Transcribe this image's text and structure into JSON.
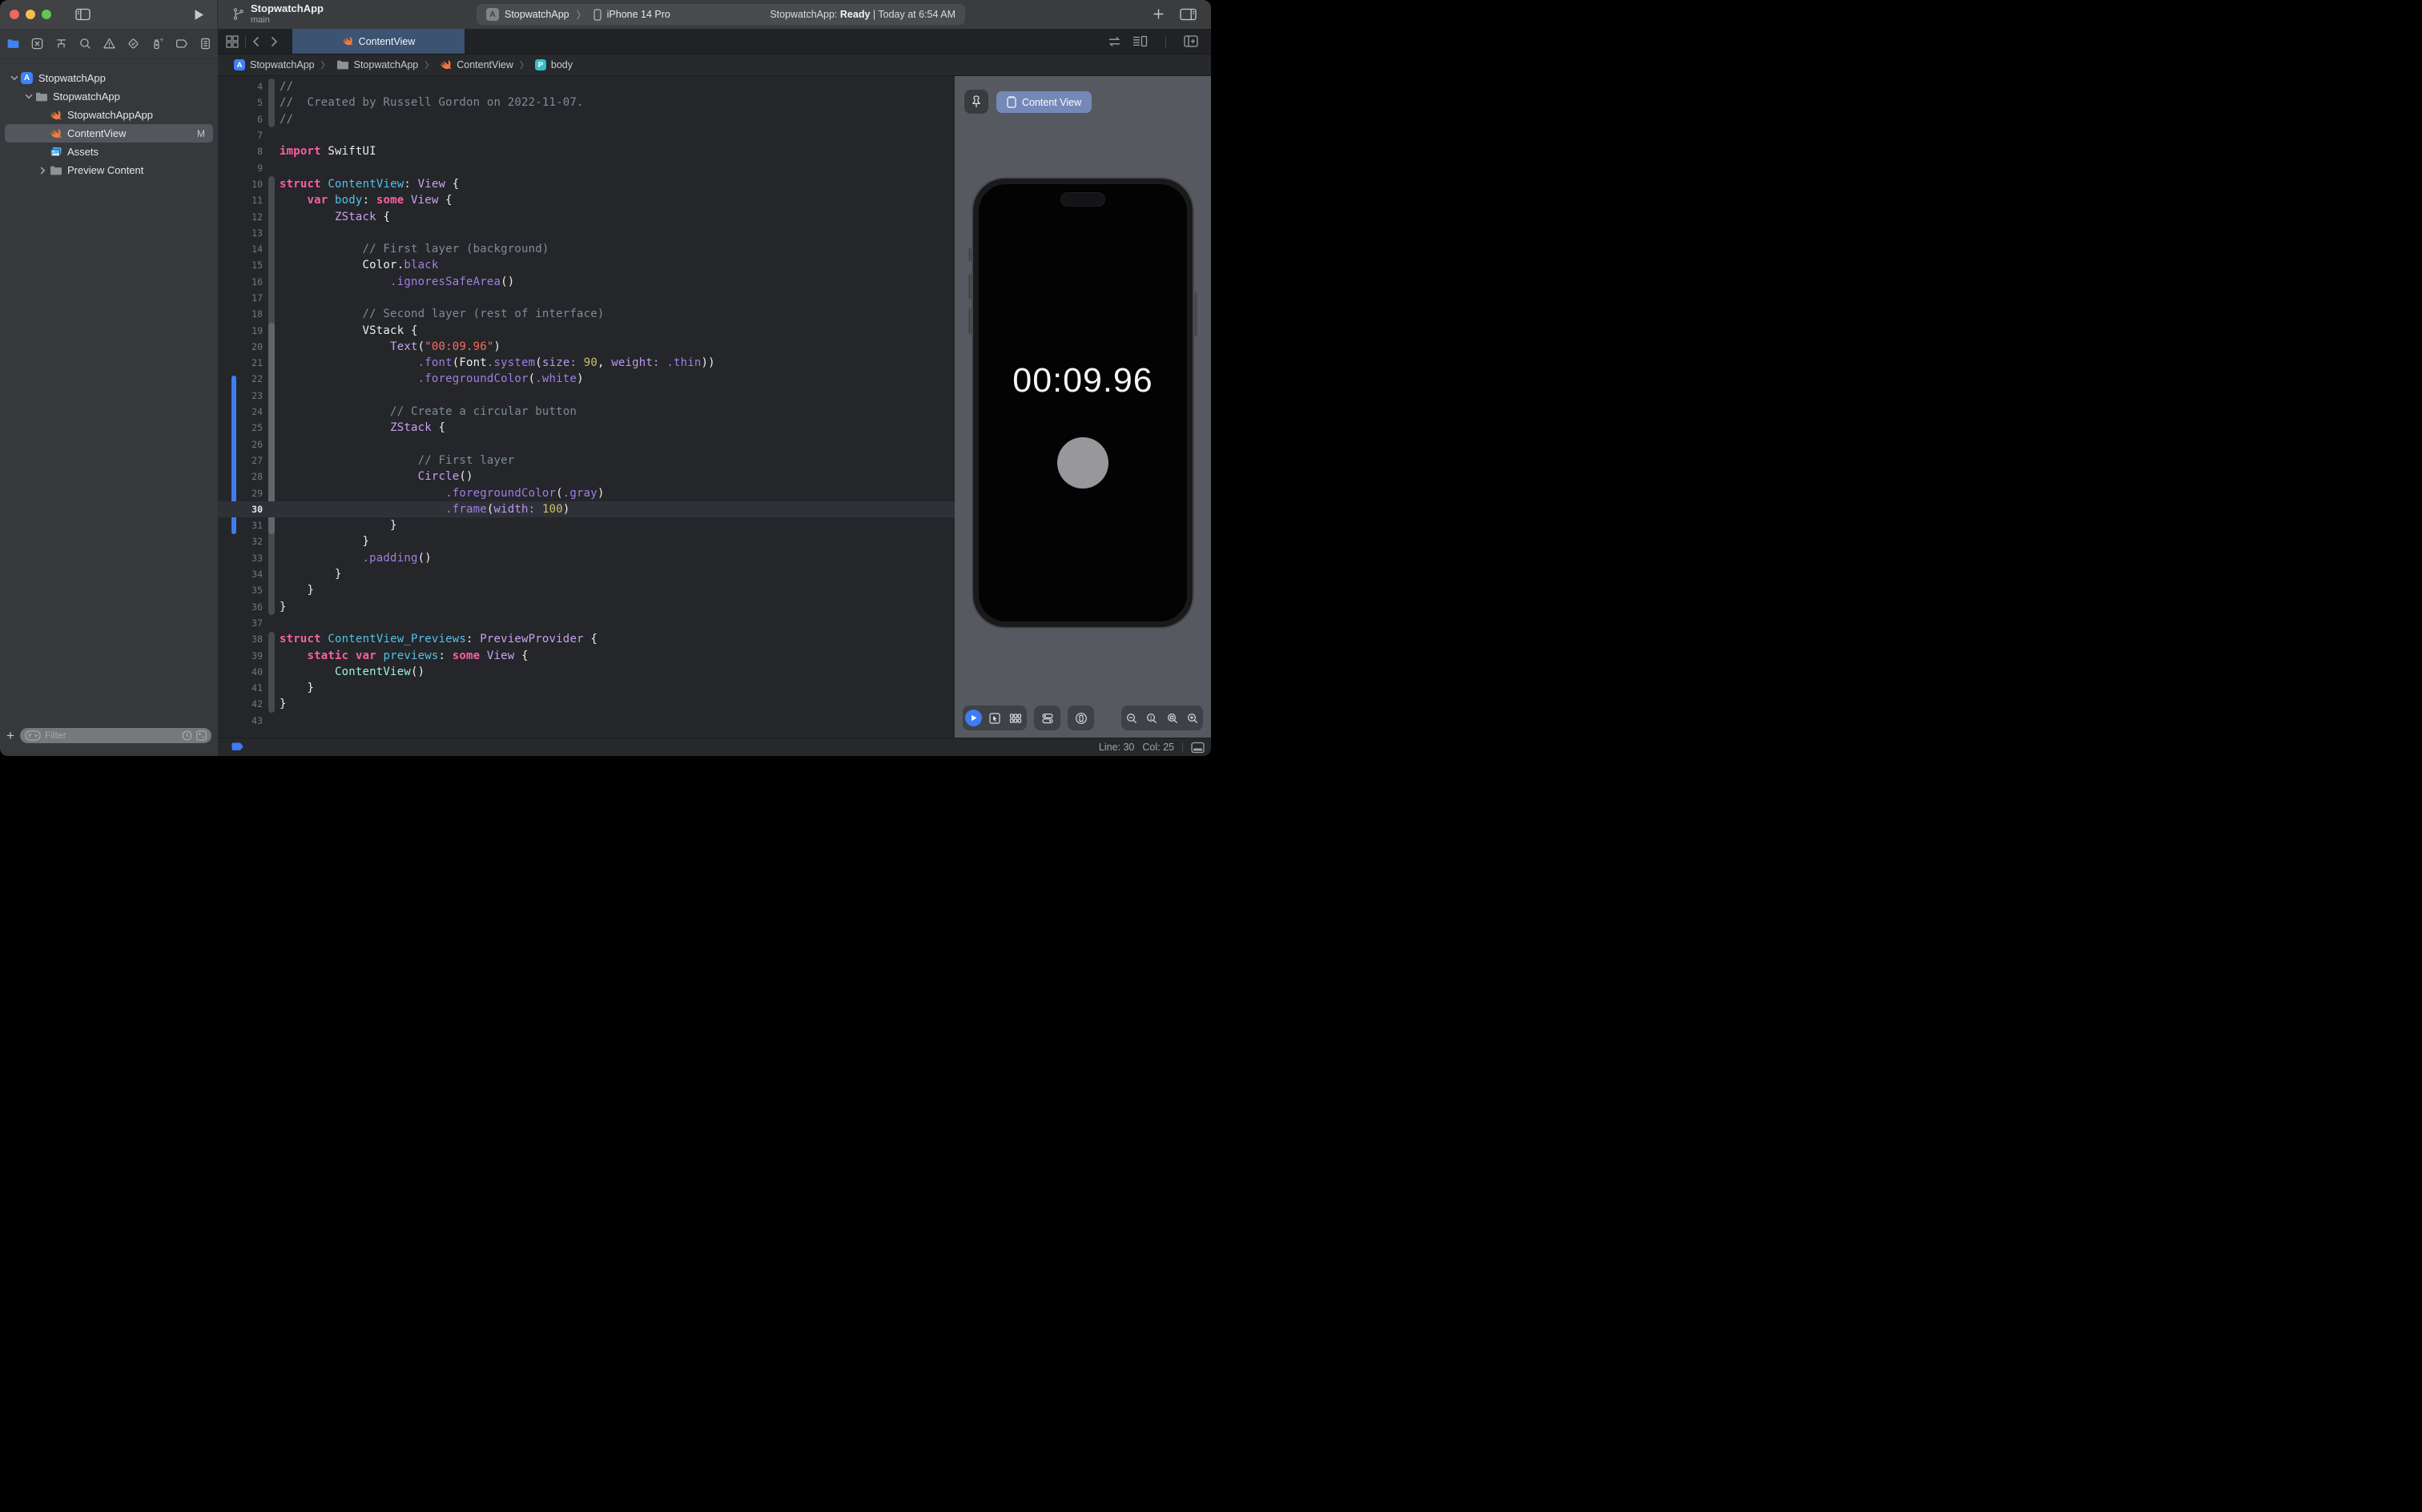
{
  "titlebar": {
    "project": "StopwatchApp",
    "branch": "main",
    "scheme": {
      "app": "StopwatchApp",
      "chevron": "〉",
      "device": "iPhone 14 Pro",
      "app_initial": "A"
    },
    "status": {
      "app": "StopwatchApp:",
      "state": "Ready",
      "sep": "|",
      "time": "Today at 6:54 AM"
    }
  },
  "navigator": {
    "active": "project-navigator",
    "icons": [
      "project-navigator",
      "source-control",
      "symbols",
      "find",
      "issues",
      "tests",
      "debug",
      "breakpoints",
      "reports"
    ]
  },
  "sidebar": {
    "items": [
      {
        "label": "StopwatchApp",
        "icon": "project",
        "disclosure": "open",
        "indent": 0
      },
      {
        "label": "StopwatchApp",
        "icon": "folder",
        "disclosure": "open",
        "indent": 1
      },
      {
        "label": "StopwatchAppApp",
        "icon": "swift",
        "indent": 2
      },
      {
        "label": "ContentView",
        "icon": "swift",
        "indent": 2,
        "selected": true,
        "badge": "M"
      },
      {
        "label": "Assets",
        "icon": "assets",
        "indent": 2
      },
      {
        "label": "Preview Content",
        "icon": "folder",
        "disclosure": "closed",
        "indent": 2
      }
    ],
    "filter": {
      "placeholder": "Filter"
    }
  },
  "tabbar": {
    "tab": {
      "label": "ContentView",
      "icon": "swift"
    }
  },
  "jumpbar": {
    "crumbs": [
      {
        "icon": "app",
        "label": "StopwatchApp"
      },
      {
        "icon": "folder",
        "label": "StopwatchApp"
      },
      {
        "icon": "swift",
        "label": "ContentView"
      },
      {
        "icon": "property",
        "label": "body"
      }
    ],
    "chevron": "〉"
  },
  "editor": {
    "current_line": 30,
    "lines": [
      {
        "n": 4,
        "t": [
          [
            "c",
            "//"
          ]
        ]
      },
      {
        "n": 5,
        "t": [
          [
            "c",
            "//  Created by Russell Gordon on 2022-11-07."
          ]
        ]
      },
      {
        "n": 6,
        "t": [
          [
            "c",
            "//"
          ]
        ]
      },
      {
        "n": 7,
        "t": []
      },
      {
        "n": 8,
        "t": [
          [
            "k",
            "import"
          ],
          [
            "p",
            " SwiftUI"
          ]
        ]
      },
      {
        "n": 9,
        "t": []
      },
      {
        "n": 10,
        "t": [
          [
            "k",
            "struct"
          ],
          [
            "p",
            " "
          ],
          [
            "d",
            "ContentView"
          ],
          [
            "p",
            ": "
          ],
          [
            "t",
            "View"
          ],
          [
            "p",
            " {"
          ]
        ]
      },
      {
        "n": 11,
        "t": [
          [
            "p",
            "    "
          ],
          [
            "k",
            "var"
          ],
          [
            "p",
            " "
          ],
          [
            "d",
            "body"
          ],
          [
            "p",
            ": "
          ],
          [
            "k",
            "some"
          ],
          [
            "p",
            " "
          ],
          [
            "t",
            "View"
          ],
          [
            "p",
            " {"
          ]
        ]
      },
      {
        "n": 12,
        "t": [
          [
            "p",
            "        "
          ],
          [
            "t",
            "ZStack"
          ],
          [
            "p",
            " {"
          ]
        ]
      },
      {
        "n": 13,
        "t": []
      },
      {
        "n": 14,
        "t": [
          [
            "c",
            "            // First layer (background)"
          ]
        ]
      },
      {
        "n": 15,
        "t": [
          [
            "p",
            "            Color."
          ],
          [
            "f",
            "black"
          ]
        ]
      },
      {
        "n": 16,
        "t": [
          [
            "p",
            "                "
          ],
          [
            "f",
            ".ignoresSafeArea"
          ],
          [
            "p",
            "()"
          ]
        ]
      },
      {
        "n": 17,
        "t": []
      },
      {
        "n": 18,
        "t": [
          [
            "c",
            "            // Second layer (rest of interface)"
          ]
        ]
      },
      {
        "n": 19,
        "t": [
          [
            "p",
            "            VStack {"
          ]
        ]
      },
      {
        "n": 20,
        "t": [
          [
            "p",
            "                "
          ],
          [
            "t",
            "Text"
          ],
          [
            "p",
            "("
          ],
          [
            "s",
            "\"00:09.96\""
          ],
          [
            "p",
            ")"
          ]
        ]
      },
      {
        "n": 21,
        "t": [
          [
            "p",
            "                    "
          ],
          [
            "f",
            ".font"
          ],
          [
            "p",
            "(Font"
          ],
          [
            "f",
            ".system"
          ],
          [
            "p",
            "("
          ],
          [
            "a",
            "size:"
          ],
          [
            "p",
            " "
          ],
          [
            "n",
            "90"
          ],
          [
            "p",
            ", "
          ],
          [
            "a",
            "weight:"
          ],
          [
            "p",
            " "
          ],
          [
            "f",
            ".thin"
          ],
          [
            "p",
            "))"
          ]
        ]
      },
      {
        "n": 22,
        "t": [
          [
            "p",
            "                    "
          ],
          [
            "f",
            ".foregroundColor"
          ],
          [
            "p",
            "("
          ],
          [
            "f",
            ".white"
          ],
          [
            "p",
            ")"
          ]
        ]
      },
      {
        "n": 23,
        "t": []
      },
      {
        "n": 24,
        "t": [
          [
            "c",
            "                // Create a circular button"
          ]
        ]
      },
      {
        "n": 25,
        "t": [
          [
            "p",
            "                "
          ],
          [
            "t",
            "ZStack"
          ],
          [
            "p",
            " {"
          ]
        ]
      },
      {
        "n": 26,
        "t": []
      },
      {
        "n": 27,
        "t": [
          [
            "c",
            "                    // First layer"
          ]
        ]
      },
      {
        "n": 28,
        "t": [
          [
            "p",
            "                    "
          ],
          [
            "t",
            "Circle"
          ],
          [
            "p",
            "()"
          ]
        ]
      },
      {
        "n": 29,
        "t": [
          [
            "p",
            "                        "
          ],
          [
            "f",
            ".foregroundColor"
          ],
          [
            "p",
            "("
          ],
          [
            "f",
            ".gray"
          ],
          [
            "p",
            ")"
          ]
        ]
      },
      {
        "n": 30,
        "t": [
          [
            "p",
            "                        "
          ],
          [
            "f",
            ".frame"
          ],
          [
            "p",
            "("
          ],
          [
            "a",
            "width:"
          ],
          [
            "p",
            " "
          ],
          [
            "n",
            "100"
          ],
          [
            "p",
            ")"
          ]
        ]
      },
      {
        "n": 31,
        "t": [
          [
            "p",
            "                }"
          ]
        ]
      },
      {
        "n": 32,
        "t": [
          [
            "p",
            "            }"
          ]
        ]
      },
      {
        "n": 33,
        "t": [
          [
            "p",
            "            "
          ],
          [
            "f",
            ".padding"
          ],
          [
            "p",
            "()"
          ]
        ]
      },
      {
        "n": 34,
        "t": [
          [
            "p",
            "        }"
          ]
        ]
      },
      {
        "n": 35,
        "t": [
          [
            "p",
            "    }"
          ]
        ]
      },
      {
        "n": 36,
        "t": [
          [
            "p",
            "}"
          ]
        ]
      },
      {
        "n": 37,
        "t": []
      },
      {
        "n": 38,
        "t": [
          [
            "k",
            "struct"
          ],
          [
            "p",
            " "
          ],
          [
            "d",
            "ContentView_Previews"
          ],
          [
            "p",
            ": "
          ],
          [
            "t",
            "PreviewProvider"
          ],
          [
            "p",
            " {"
          ]
        ]
      },
      {
        "n": 39,
        "t": [
          [
            "p",
            "    "
          ],
          [
            "k",
            "static"
          ],
          [
            "p",
            " "
          ],
          [
            "k",
            "var"
          ],
          [
            "p",
            " "
          ],
          [
            "d",
            "previews"
          ],
          [
            "p",
            ": "
          ],
          [
            "k",
            "some"
          ],
          [
            "p",
            " "
          ],
          [
            "t",
            "View"
          ],
          [
            "p",
            " {"
          ]
        ]
      },
      {
        "n": 40,
        "t": [
          [
            "p",
            "        "
          ],
          [
            "m",
            "ContentView"
          ],
          [
            "p",
            "()"
          ]
        ]
      },
      {
        "n": 41,
        "t": [
          [
            "p",
            "    }"
          ]
        ]
      },
      {
        "n": 42,
        "t": [
          [
            "p",
            "}"
          ]
        ]
      },
      {
        "n": 43,
        "t": []
      }
    ]
  },
  "canvas": {
    "chip_label": "Content View",
    "device": {
      "time": "00:09.96",
      "circle_color": "#97979C"
    },
    "toolbar_groups": [
      [
        "live-preview-play",
        "selectable-cursor",
        "variants-grid"
      ],
      [
        "device-settings-toggles"
      ],
      [
        "preview-on-device-phone"
      ]
    ],
    "zoom_group": [
      "zoom-out",
      "zoom-100",
      "zoom-fit",
      "zoom-in"
    ]
  },
  "statusbar": {
    "line": "Line: 30",
    "col": "Col: 25"
  },
  "colors": {
    "accent_blue": "#3E82F7",
    "tab_blue": "#3C5372",
    "chip_blue": "#7589B8",
    "swift_orange": "#EE7B3E"
  }
}
